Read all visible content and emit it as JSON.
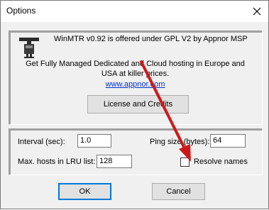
{
  "window": {
    "title": "Options"
  },
  "about": {
    "license_line": "WinMTR v0.92 is offered under GPL V2 by Appnor MSP",
    "promo_line1": "Get Fully Managed Dedicated and Cloud hosting in Europe and",
    "promo_line2": "USA at killer prices.",
    "link_text": "www.appnor.com",
    "license_button": "License and Credits"
  },
  "settings": {
    "interval_label": "Interval (sec):",
    "interval_value": "1.0",
    "ping_size_label": "Ping size (bytes):",
    "ping_size_value": "64",
    "max_hosts_label": "Max. hosts in LRU list:",
    "max_hosts_value": "128",
    "resolve_names_label": "Resolve names",
    "resolve_names_checked": false
  },
  "buttons": {
    "ok": "OK",
    "cancel": "Cancel"
  },
  "colors": {
    "annotation_arrow": "#cc1a1a",
    "link": "#0033cc"
  }
}
